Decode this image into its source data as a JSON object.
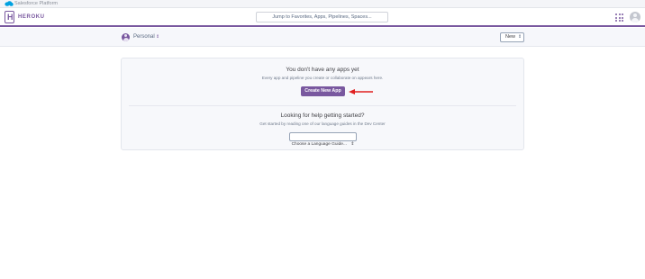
{
  "platform_bar": {
    "label": "Salesforce Platform",
    "icon": "salesforce-cloud-icon",
    "color": "#00a1e0"
  },
  "header": {
    "logo_letter": "H",
    "wordmark": "HEROKU",
    "search_placeholder": "Jump to Favorites, Apps, Pipelines, Spaces...",
    "apps_icon": "app-launcher-grid-icon",
    "avatar_icon": "user-avatar-icon",
    "accent_color": "#79589f"
  },
  "subnav": {
    "account_label": "Personal",
    "account_chevron": "⇕",
    "new_button_label": "New",
    "new_button_chevron": "⇕"
  },
  "empty_state": {
    "title": "You don't have any apps yet",
    "subtitle": "Every app and pipeline you create or collaborate on appears here.",
    "create_button": "Create New App",
    "annotation": "red-arrow-pointing-left"
  },
  "help": {
    "title": "Looking for help getting started?",
    "subtitle": "Get started by reading one of our language guides in the Dev Center",
    "select_label": "Choose a Language Guide...",
    "select_chevron": "⇕"
  }
}
